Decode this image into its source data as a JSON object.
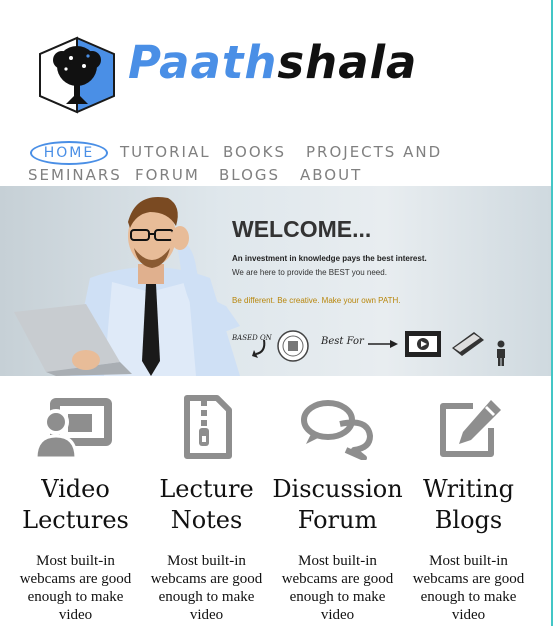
{
  "brand": {
    "name_part1": "Paath",
    "name_part2": "shala"
  },
  "nav": {
    "items": [
      {
        "label": "HOME",
        "active": true
      },
      {
        "label": "TUTORIAL"
      },
      {
        "label": "BOOKS"
      },
      {
        "label": "PROJECTS AND"
      },
      {
        "label": "SEMINARS"
      },
      {
        "label": "FORUM"
      },
      {
        "label": "BLOGS"
      },
      {
        "label": "ABOUT"
      }
    ]
  },
  "banner": {
    "title": "WELCOME...",
    "line1": "An investment in knowledge pays the best interest.",
    "line2": "We are here to provide the BEST you need.",
    "line3": "Be different. Be creative. Make your own PATH.",
    "based_on": "BASED ON",
    "best_for": "Best For"
  },
  "features": [
    {
      "title": "Video Lectures",
      "desc": "Most built-in webcams are good enough to make video",
      "icon": "video-lecture-icon"
    },
    {
      "title": "Lecture Notes",
      "desc": "Most built-in webcams are good enough to make video",
      "icon": "zip-file-icon"
    },
    {
      "title": "Discussion Forum",
      "desc": "Most built-in webcams are good enough to make video",
      "icon": "chat-bubbles-icon"
    },
    {
      "title": "Writing Blogs",
      "desc": "Most built-in webcams are good enough to make video",
      "icon": "edit-icon"
    }
  ],
  "colors": {
    "accent": "#4a8fe6",
    "icon_gray": "#8e8e8e",
    "nav_gray": "#808080",
    "edge": "#43c6c6"
  }
}
